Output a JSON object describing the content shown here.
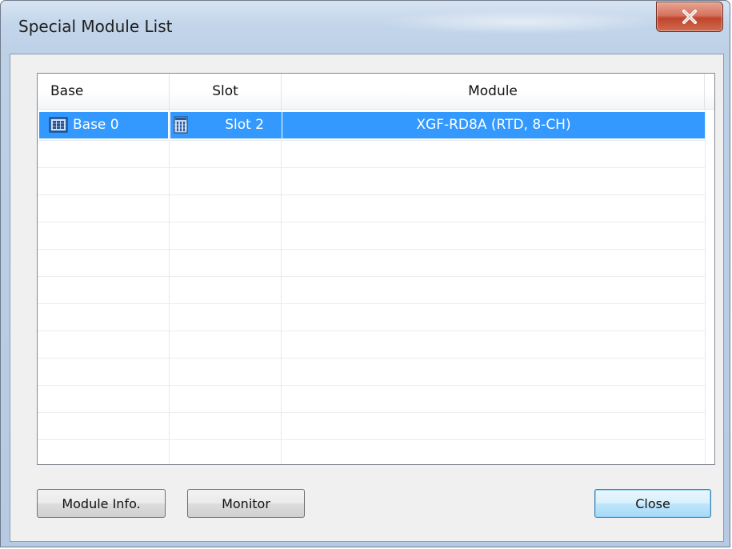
{
  "window": {
    "title": "Special Module List",
    "close_glyph": "x"
  },
  "list": {
    "columns": [
      "Base",
      "Slot",
      "Module"
    ],
    "rows": [
      {
        "base": "Base 0",
        "slot": "Slot 2",
        "module": "XGF-RD8A (RTD, 8-CH)",
        "selected": true
      }
    ],
    "empty_row_count": 11
  },
  "buttons": {
    "module_info": "Module Info.",
    "monitor": "Monitor",
    "close": "Close"
  },
  "colors": {
    "selection": "#3399ff",
    "close_button": "#c0452d"
  },
  "icons": [
    "base-icon",
    "slot-icon",
    "close-x-icon"
  ]
}
